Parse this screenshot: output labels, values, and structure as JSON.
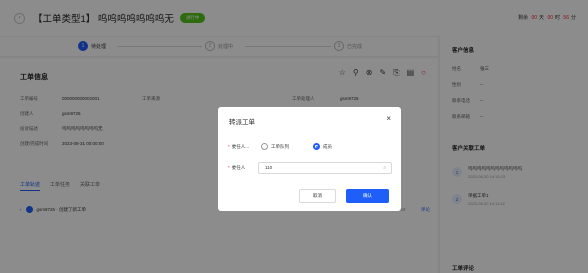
{
  "header": {
    "back_icon": "chevron-left-icon",
    "title": "【工单类型1】 呜呜呜呜呜呜呜无",
    "status_tag": "进行中",
    "timer": {
      "prefix": "剩余",
      "days": "00",
      "days_unit": "天",
      "hours": "00",
      "hours_unit": "时",
      "minutes": "56",
      "minutes_unit": "分"
    }
  },
  "steps": [
    {
      "num": "1",
      "label": "待处理"
    },
    {
      "num": "2",
      "label": "处理中"
    },
    {
      "num": "3",
      "label": "已完成"
    }
  ],
  "ticket_info": {
    "title": "工单信息",
    "fields": [
      {
        "key": "工单编号",
        "value": "000000000002001"
      },
      {
        "key": "工单来源",
        "value": ""
      },
      {
        "key": "工单处理人",
        "value": "gsm9726"
      },
      {
        "key": "创建人",
        "value": "gsm9726"
      },
      {
        "key": "投诉描述",
        "value": "呜呜呜呜呜呜呜呜无"
      },
      {
        "key": "创建/完成时间",
        "value": "2023-08-31 00:00:00"
      }
    ],
    "tools": [
      "star-icon",
      "pin-icon",
      "close-circle-icon",
      "edit-icon",
      "share-icon",
      "document-icon",
      "circle-icon"
    ]
  },
  "tabs": [
    "工单轨迹",
    "工单任务",
    "关联工单"
  ],
  "log": {
    "text": "gsm9726 · 创建了新工单",
    "date": "2023-08-30 14:59",
    "action": "评论"
  },
  "side": {
    "customer_title": "客户信息",
    "customer": [
      {
        "key": "姓名",
        "value": "张三"
      },
      {
        "key": "性别",
        "value": "--"
      },
      {
        "key": "联系电话",
        "value": "--"
      },
      {
        "key": "联系邮箱",
        "value": "--"
      }
    ],
    "related_title": "客户关联工单",
    "related": [
      {
        "num": "1",
        "name": "呜呜呜呜呜呜呜呜呜呜呜呜",
        "date": "2023-08-30 14:15:23"
      },
      {
        "num": "2",
        "name": "单据工单1",
        "date": "2023-08-30 14:11:52"
      }
    ],
    "comment_title": "工单评论"
  },
  "modal": {
    "title": "转派工单",
    "close_icon": "close-icon",
    "assign_type_label": "委任人...",
    "option_team": "工单队列",
    "option_person": "成员",
    "assignee_label": "委任人",
    "assignee_value": "110",
    "search_icon": "search-icon",
    "cancel": "取消",
    "confirm": "确认"
  }
}
